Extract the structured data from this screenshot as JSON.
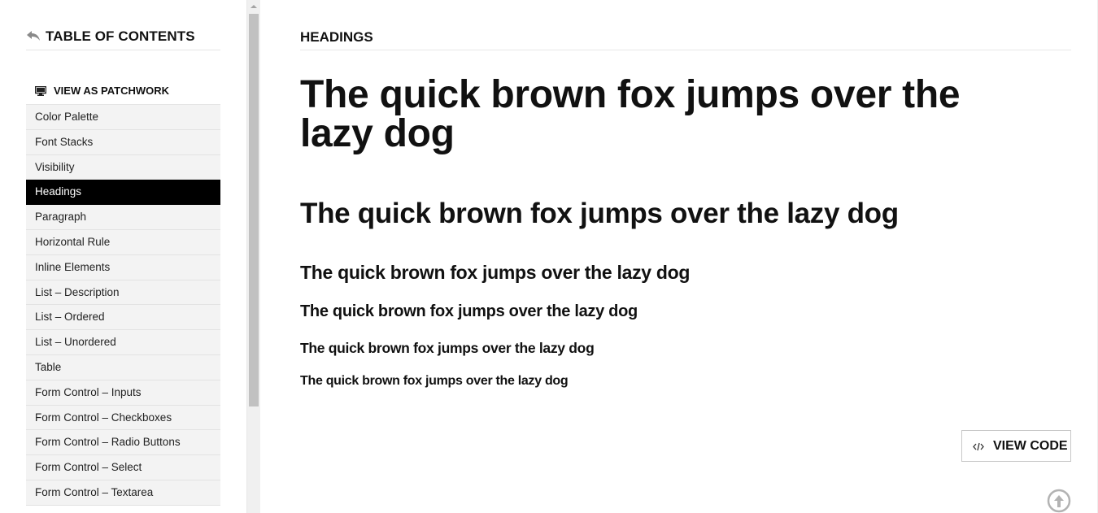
{
  "sidebar": {
    "title": "TABLE OF CONTENTS",
    "patchwork_label": "VIEW AS PATCHWORK",
    "items": [
      {
        "label": "Color Palette"
      },
      {
        "label": "Font Stacks"
      },
      {
        "label": "Visibility"
      },
      {
        "label": "Headings",
        "active": true
      },
      {
        "label": "Paragraph"
      },
      {
        "label": "Horizontal Rule"
      },
      {
        "label": "Inline Elements"
      },
      {
        "label": "List – Description"
      },
      {
        "label": "List – Ordered"
      },
      {
        "label": "List – Unordered"
      },
      {
        "label": "Table"
      },
      {
        "label": "Form Control – Inputs"
      },
      {
        "label": "Form Control – Checkboxes"
      },
      {
        "label": "Form Control – Radio Buttons"
      },
      {
        "label": "Form Control – Select"
      },
      {
        "label": "Form Control – Textarea"
      }
    ]
  },
  "main": {
    "section_title": "HEADINGS",
    "headings": {
      "h1": "The quick brown fox jumps over the lazy dog",
      "h2": "The quick brown fox jumps over the lazy dog",
      "h3": "The quick brown fox jumps over the lazy dog",
      "h4": "The quick brown fox jumps over the lazy dog",
      "h5": "The quick brown fox jumps over the lazy dog",
      "h6": "The quick brown fox jumps over the lazy dog"
    },
    "view_code_label": "VIEW CODE"
  },
  "icons": {
    "toc_back": "reply-arrow-icon",
    "patchwork": "monitor-icon",
    "code": "code-icon",
    "back_to_top": "arrow-up-circle-icon"
  },
  "colors": {
    "active_bg": "#000000",
    "nav_bg": "#f3f3f3",
    "text": "#111111"
  }
}
